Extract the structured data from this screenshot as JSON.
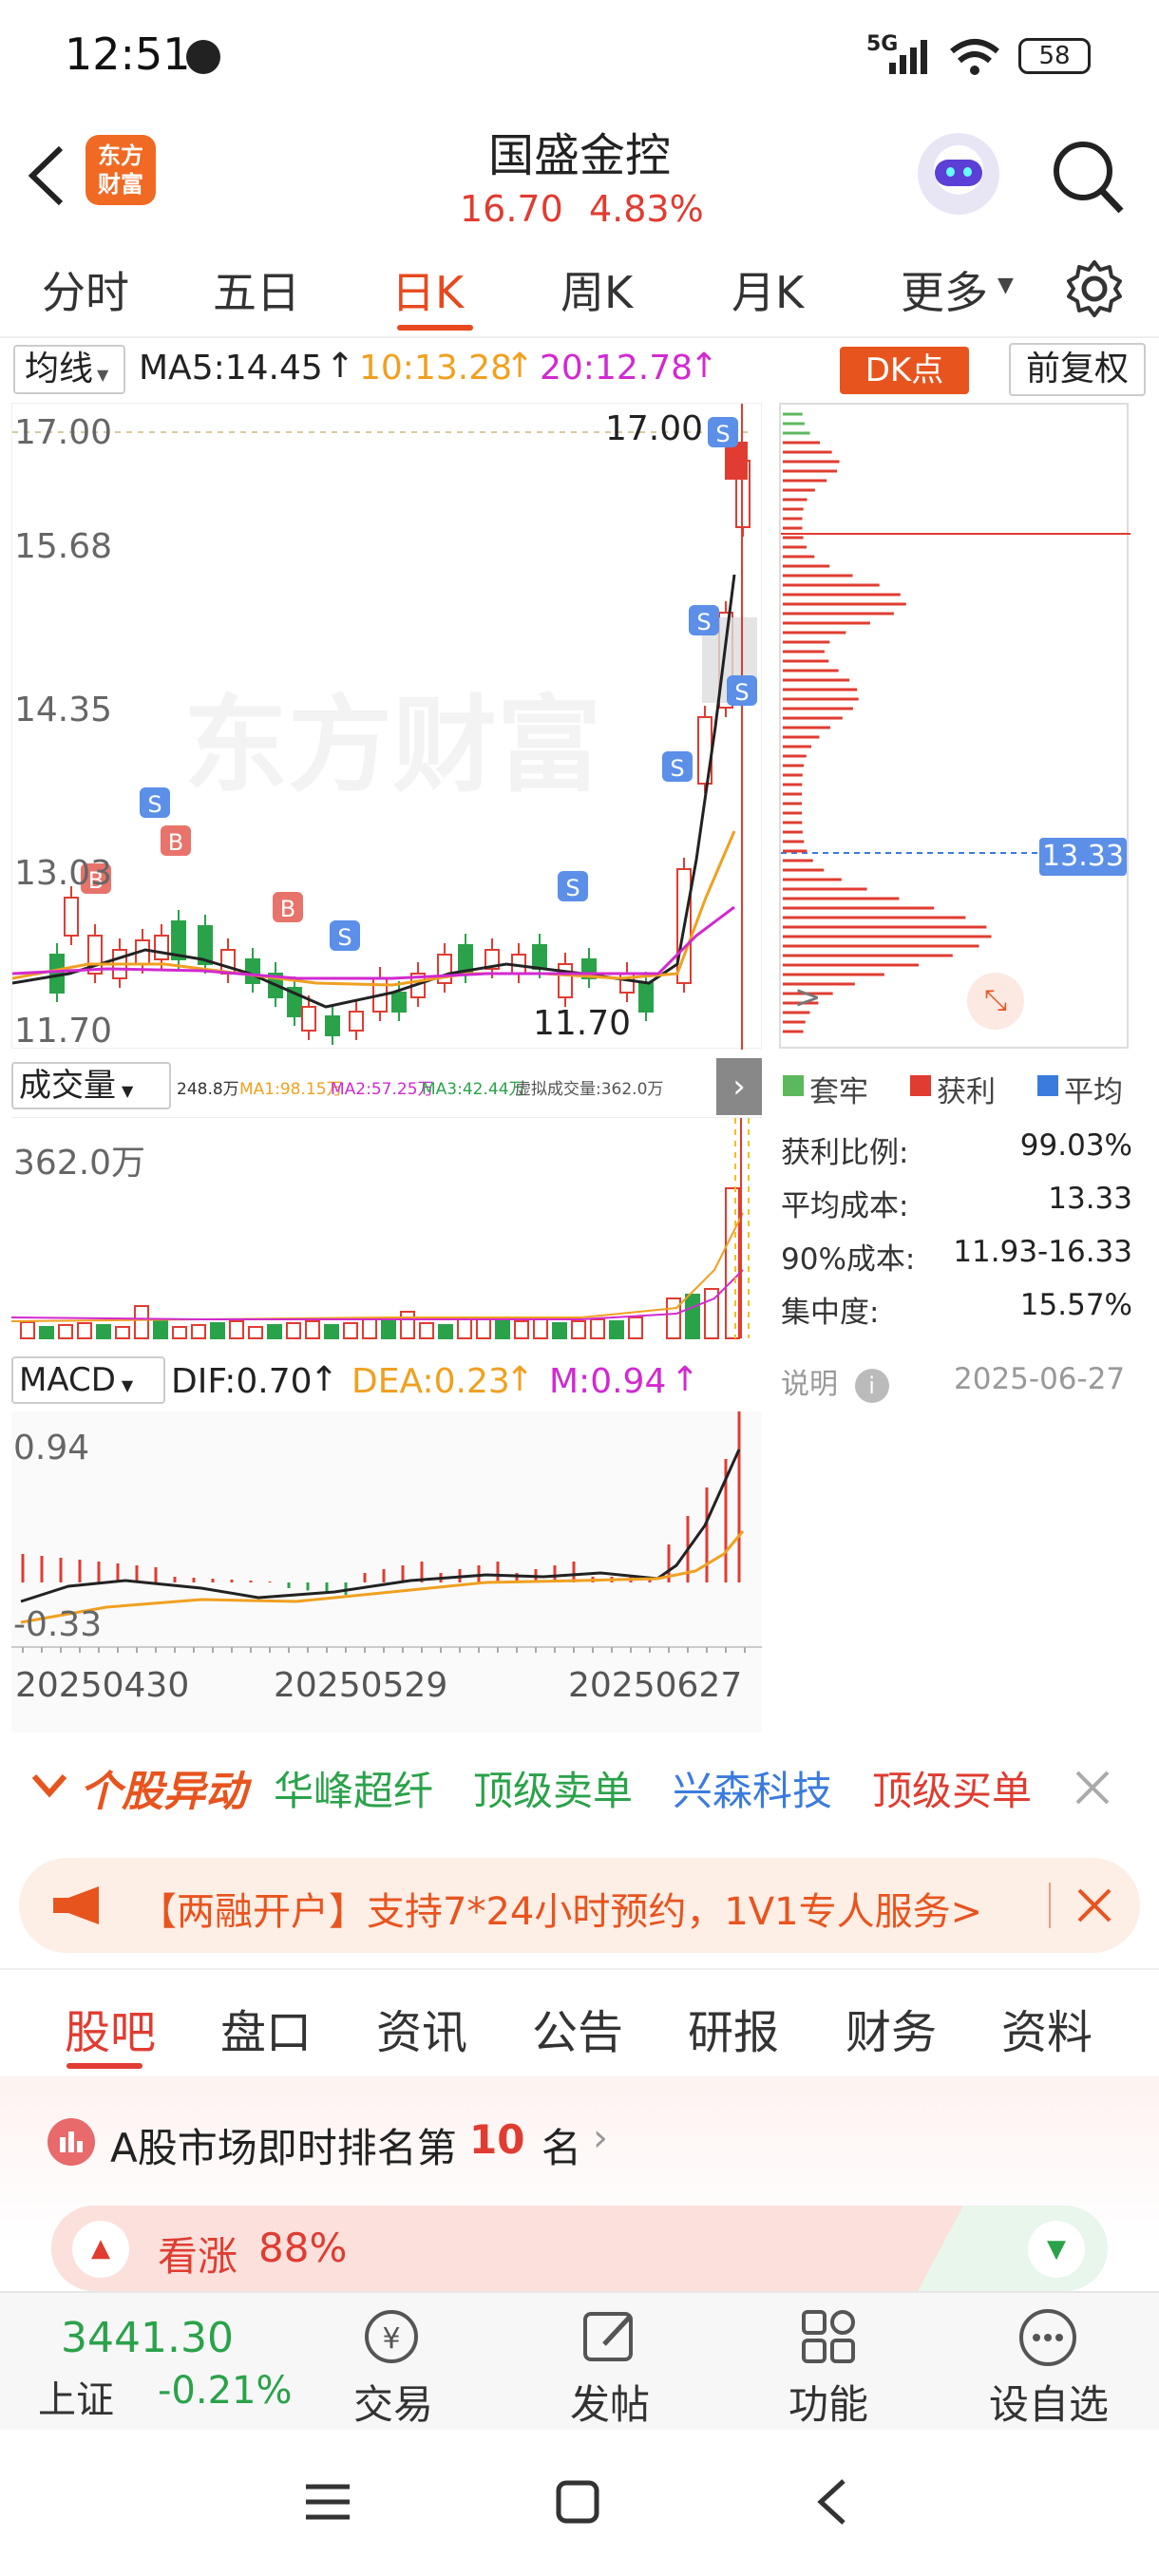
{
  "status": {
    "time": "12:51",
    "network": "5G",
    "battery": "58"
  },
  "header": {
    "logo_top": "东方",
    "logo_bottom": "财富",
    "title": "国盛金控",
    "price": "16.70",
    "change": "4.83%"
  },
  "tabs": [
    "分时",
    "五日",
    "日K",
    "周K",
    "月K",
    "更多"
  ],
  "active_tab": "日K",
  "indicators": {
    "ma_label": "均线",
    "ma5": "MA5:14.45",
    "ma10": "10:13.28",
    "ma20": "20:12.78",
    "dk": "DK点",
    "adjust": "前复权"
  },
  "chart_data": {
    "type": "candlestick",
    "price_axis": [
      "17.00",
      "15.68",
      "14.35",
      "13.03",
      "11.70"
    ],
    "high_label": "17.00",
    "low_label": "11.70",
    "watermark": "东方财富",
    "x_labels": [
      "20250430",
      "20250529",
      "20250627"
    ],
    "volume": {
      "label": "成交量",
      "summary": "248.8万",
      "ma1": "MA1:98.15万",
      "ma2": "MA2:57.25万",
      "ma3": "MA3:42.44万",
      "virtual": "虚拟成交量:362.0万",
      "max": "362.0万"
    },
    "macd": {
      "label": "MACD",
      "dif": "DIF:0.70",
      "dea": "DEA:0.23",
      "m": "M:0.94",
      "top": "0.94",
      "bottom": "-0.33"
    },
    "chip": {
      "avg_label": "13.33",
      "legend": [
        "套牢",
        "获利",
        "平均"
      ],
      "rows": [
        {
          "k": "获利比例:",
          "v": "99.03%"
        },
        {
          "k": "平均成本:",
          "v": "13.33"
        },
        {
          "k": "90%成本:",
          "v": "11.93-16.33"
        },
        {
          "k": "集中度:",
          "v": "15.57%"
        }
      ],
      "note": "说明",
      "date": "2025-06-27"
    }
  },
  "news": {
    "tag": "个股异动",
    "items": [
      "华峰超纤",
      "顶级卖单",
      "兴森科技",
      "顶级买单"
    ]
  },
  "banner": {
    "text": "【两融开户】支持7*24小时预约，1V1专人服务>"
  },
  "subtabs": [
    "股吧",
    "盘口",
    "资讯",
    "公告",
    "研报",
    "财务",
    "资料"
  ],
  "active_subtab": "股吧",
  "rank": {
    "text_a": "A股市场即时排名第",
    "num": "10",
    "text_b": "名"
  },
  "sentiment": {
    "label": "看涨",
    "pct": "88%"
  },
  "bottom": {
    "index_value": "3441.30",
    "index_name": "上证",
    "index_change": "-0.21%",
    "items": [
      "交易",
      "发帖",
      "功能",
      "设自选"
    ]
  }
}
